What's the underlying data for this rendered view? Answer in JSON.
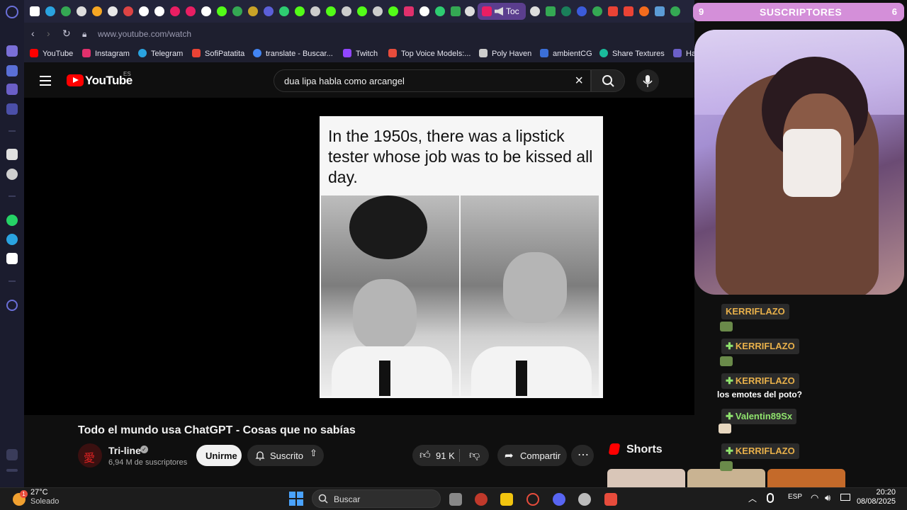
{
  "browser": {
    "url": "www.youtube.com/watch",
    "active_tab_label": "Toc",
    "bookmarks": [
      "YouTube",
      "Instagram",
      "Telegram",
      "SofiPatatita",
      "translate - Buscar...",
      "Twitch",
      "Top Voice Models:...",
      "Poly Haven",
      "ambientCG",
      "Share Textures",
      "Har"
    ]
  },
  "youtube": {
    "logo_text": "YouTube",
    "region": "ES",
    "search_value": "dua lipa habla como arcangel",
    "video_title": "Todo el mundo usa ChatGPT - Cosas que no sabías",
    "channel_name": "Tri-line",
    "subscribers": "6,94 M de suscriptores",
    "join_label": "Unirme",
    "subscribed_label": "Suscrito",
    "likes": "91 K",
    "share_label": "Compartir",
    "shorts_label": "Shorts",
    "meme_caption": "In the 1950s, there was a lipstick tester whose job was to be kissed all day."
  },
  "stream_overlay": {
    "banner_left": "9",
    "banner_title": "SUSCRIPTORES",
    "banner_right": "6",
    "chat": [
      {
        "name": "KERRIFLAZO",
        "color": "#e8b04a"
      },
      {
        "name": "KERRIFLAZO",
        "color": "#e8b04a"
      },
      {
        "name": "KERRIFLAZO",
        "color": "#e8b04a"
      },
      {
        "name": "Valentin89Sx",
        "color": "#8fe36d"
      },
      {
        "name": "KERRIFLAZO",
        "color": "#e8b04a"
      }
    ],
    "chat_message": "los emotes del poto?"
  },
  "taskbar": {
    "temperature": "27°C",
    "weather": "Soleado",
    "weather_badge": "1",
    "search_label": "Buscar",
    "language": "ESP",
    "time": "20:20",
    "date": "08/08/2025"
  }
}
